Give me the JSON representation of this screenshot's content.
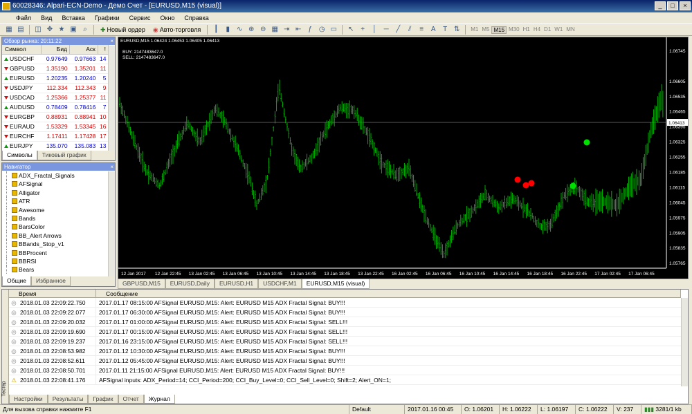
{
  "window": {
    "title": "60028346: Alpari-ECN-Demo - Демо Счет - [EURUSD,M15 (visual)]"
  },
  "menu": [
    "Файл",
    "Вид",
    "Вставка",
    "Графики",
    "Сервис",
    "Окно",
    "Справка"
  ],
  "toolbar": {
    "new_order": "Новый ордер",
    "autotrading": "Авто-торговля",
    "timeframes": [
      "M1",
      "M5",
      "M15",
      "M30",
      "H1",
      "H4",
      "D1",
      "W1",
      "MN"
    ],
    "active_tf": "M15"
  },
  "market_watch": {
    "title": "Обзор рынка: 20:11:22",
    "headers": [
      "Символ",
      "Бид",
      "Аск",
      "!"
    ],
    "rows": [
      {
        "symbol": "USDCHF",
        "bid": "0.97649",
        "ask": "0.97663",
        "spread": "14",
        "dir": "up"
      },
      {
        "symbol": "GBPUSD",
        "bid": "1.35190",
        "ask": "1.35201",
        "spread": "11",
        "dir": "down"
      },
      {
        "symbol": "EURUSD",
        "bid": "1.20235",
        "ask": "1.20240",
        "spread": "5",
        "dir": "up"
      },
      {
        "symbol": "USDJPY",
        "bid": "112.334",
        "ask": "112.343",
        "spread": "9",
        "dir": "down"
      },
      {
        "symbol": "USDCAD",
        "bid": "1.25366",
        "ask": "1.25377",
        "spread": "11",
        "dir": "down"
      },
      {
        "symbol": "AUDUSD",
        "bid": "0.78409",
        "ask": "0.78416",
        "spread": "7",
        "dir": "up"
      },
      {
        "symbol": "EURGBP",
        "bid": "0.88931",
        "ask": "0.88941",
        "spread": "10",
        "dir": "down"
      },
      {
        "symbol": "EURAUD",
        "bid": "1.53329",
        "ask": "1.53345",
        "spread": "16",
        "dir": "down"
      },
      {
        "symbol": "EURCHF",
        "bid": "1.17411",
        "ask": "1.17428",
        "spread": "17",
        "dir": "down"
      },
      {
        "symbol": "EURJPY",
        "bid": "135.070",
        "ask": "135.083",
        "spread": "13",
        "dir": "up"
      }
    ],
    "tabs": [
      "Символы",
      "Тиковый график"
    ]
  },
  "navigator": {
    "title": "Навигатор",
    "items": [
      "ADX_Fractal_Signals",
      "AFSignal",
      "Alligator",
      "ATR",
      "Awesome",
      "Bands",
      "BarsColor",
      "BB_Alert Arrows",
      "BBands_Stop_v1",
      "BBProcent",
      "BBRSI",
      "Bears"
    ],
    "tabs": [
      "Общие",
      "Избранное"
    ]
  },
  "chart": {
    "header": "EURUSD,M15  1.06424 1.06453 1.06405 1.06413",
    "info": [
      "BUY: 2147483647.0",
      "SELL: 2147483647.0"
    ],
    "price_labels": [
      "1.06745",
      "1.06605",
      "1.06535",
      "1.06465",
      "1.06395",
      "1.06325",
      "1.06255",
      "1.06185",
      "1.06115",
      "1.06045",
      "1.05975",
      "1.05905",
      "1.05835",
      "1.05765"
    ],
    "current_price": "1.06413",
    "time_labels": [
      "12 Jan 2017",
      "12 Jan 22:45",
      "13 Jan 02:45",
      "13 Jan 06:45",
      "13 Jan 10:45",
      "13 Jan 14:45",
      "13 Jan 18:45",
      "13 Jan 22:45",
      "16 Jan 02:45",
      "16 Jan 06:45",
      "16 Jan 10:45",
      "16 Jan 14:45",
      "16 Jan 18:45",
      "16 Jan 22:45",
      "17 Jan 02:45",
      "17 Jan 06:45"
    ],
    "colors": {
      "bg": "#000000",
      "bars": "#00c000",
      "sell_dot": "#ff0000",
      "buy_dot": "#00e000"
    },
    "tabs": [
      "GBPUSD,M15",
      "EURUSD,Daily",
      "EURUSD,H1",
      "USDCHF,M1",
      "EURUSD,M15 (visual)"
    ]
  },
  "terminal": {
    "columns": [
      "Время",
      "Сообщение"
    ],
    "side_label": "Тестер",
    "rows": [
      {
        "time": "2018.01.03 22:09:22.750",
        "msg": "2017.01.17 08:15:00   AFSignal EURUSD,M15: Alert: EURUSD M15 ADX Fractal Signal: BUY!!!"
      },
      {
        "time": "2018.01.03 22:09:22.077",
        "msg": "2017.01.17 06:30:00   AFSignal EURUSD,M15: Alert: EURUSD M15 ADX Fractal Signal: BUY!!!"
      },
      {
        "time": "2018.01.03 22:09:20.032",
        "msg": "2017.01.17 01:00:00   AFSignal EURUSD,M15: Alert: EURUSD M15 ADX Fractal Signal: SELL!!!"
      },
      {
        "time": "2018.01.03 22:09:19.690",
        "msg": "2017.01.17 00:15:00   AFSignal EURUSD,M15: Alert: EURUSD M15 ADX Fractal Signal: SELL!!!"
      },
      {
        "time": "2018.01.03 22:09:19.237",
        "msg": "2017.01.16 23:15:00   AFSignal EURUSD,M15: Alert: EURUSD M15 ADX Fractal Signal: SELL!!!"
      },
      {
        "time": "2018.01.03 22:08:53.982",
        "msg": "2017.01.12 10:30:00   AFSignal EURUSD,M15: Alert: EURUSD M15 ADX Fractal Signal: BUY!!!"
      },
      {
        "time": "2018.01.03 22:08:52.611",
        "msg": "2017.01.12 05:45:00   AFSignal EURUSD,M15: Alert: EURUSD M15 ADX Fractal Signal: BUY!!!"
      },
      {
        "time": "2018.01.03 22:08:50.701",
        "msg": "2017.01.11 21:15:00   AFSignal EURUSD,M15: Alert: EURUSD M15 ADX Fractal Signal: BUY!!!"
      },
      {
        "time": "2018.01.03 22:08:41.176",
        "msg": "AFSignal inputs: ADX_Period=14; CCI_Period=200; CCI_Buy_Level=0; CCI_Sell_Level=0; Shift=2; Alert_ON=1;"
      }
    ],
    "tabs": [
      "Настройки",
      "Результаты",
      "График",
      "Отчет",
      "Журнал"
    ]
  },
  "status": {
    "help": "Для вызова справки нажмите F1",
    "profile": "Default",
    "datetime": "2017.01.16 00:45",
    "open": "O: 1.06201",
    "high": "H: 1.06222",
    "low": "L: 1.06197",
    "close": "C: 1.06222",
    "volume": "V: 237",
    "traffic": "3281/1 kb"
  }
}
